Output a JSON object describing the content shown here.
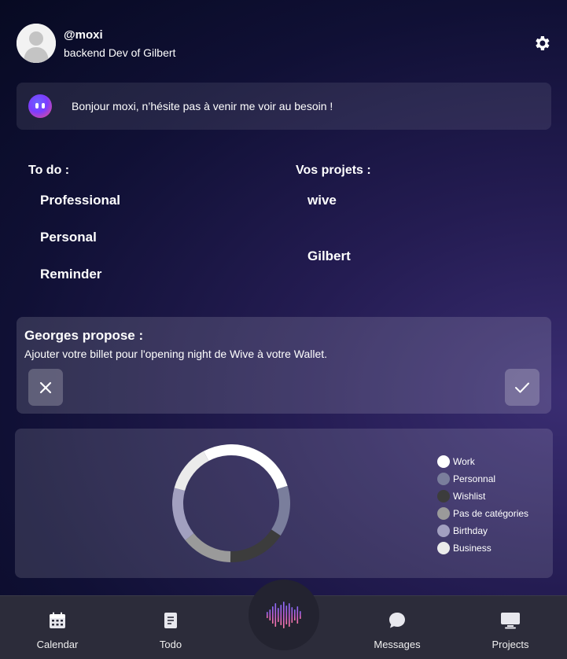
{
  "profile": {
    "handle": "@moxi",
    "role": "backend Dev of Gilbert",
    "avatar_icon": "user-silhouette-icon",
    "settings_icon": "gear-icon"
  },
  "greeting": {
    "bot_icon": "bot-face-icon",
    "text": "Bonjour moxi, n’hésite pas à venir me voir au besoin !"
  },
  "todo": {
    "title": "To do :",
    "items": [
      "Professional",
      "Personal",
      "Reminder"
    ]
  },
  "projects": {
    "title": "Vos projets :",
    "items": [
      "wive",
      "Gilbert"
    ]
  },
  "proposal": {
    "title": "Georges propose :",
    "text": "Ajouter votre billet pour l'opening night de Wive à votre Wallet.",
    "decline_icon": "close-icon",
    "accept_icon": "check-icon"
  },
  "chart_data": {
    "type": "pie",
    "categories": [
      "Work",
      "Personnal",
      "Wishlist",
      "Pas de catégories",
      "Birthday",
      "Business"
    ],
    "values": [
      28,
      14,
      16,
      14,
      15,
      13
    ],
    "colors": [
      "#ffffff",
      "#7a7e9c",
      "#3c3c3c",
      "#9a9a9a",
      "#a2a0c0",
      "#ebebeb"
    ],
    "legend": "right"
  },
  "nav": {
    "items": [
      {
        "label": "Calendar",
        "icon": "calendar-icon"
      },
      {
        "label": "Todo",
        "icon": "notebook-icon"
      },
      {
        "label": "Messages",
        "icon": "chat-bubble-icon"
      },
      {
        "label": "Projects",
        "icon": "monitor-icon"
      }
    ],
    "center_icon": "voice-waveform-icon"
  }
}
